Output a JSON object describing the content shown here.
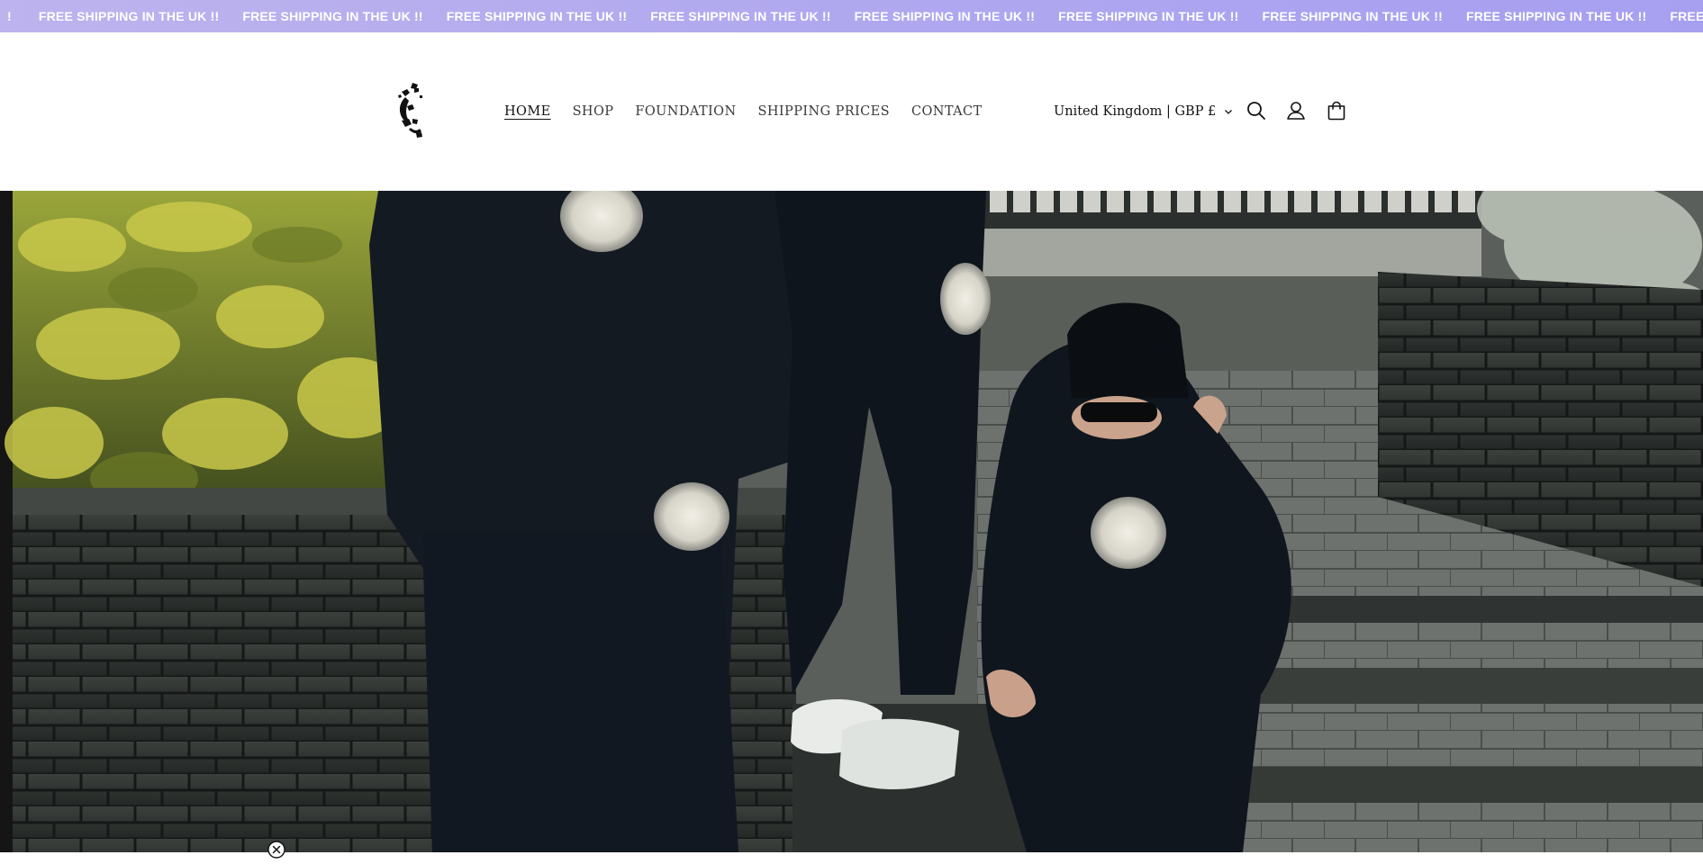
{
  "announcement": {
    "lead": "!",
    "text": "FREE SHIPPING IN THE UK !!",
    "repeat_count": 9
  },
  "header": {
    "logo_icon": "brand-logo-icon",
    "nav": [
      {
        "label": "HOME",
        "active": true
      },
      {
        "label": "SHOP",
        "active": false
      },
      {
        "label": "FOUNDATION",
        "active": false
      },
      {
        "label": "SHIPPING PRICES",
        "active": false
      },
      {
        "label": "CONTACT",
        "active": false
      }
    ],
    "region_selector": {
      "value": "United Kingdom | GBP £",
      "icon": "chevron-down-icon"
    },
    "icons": [
      "search-icon",
      "account-icon",
      "cart-icon"
    ]
  },
  "hero": {
    "image": "models-in-black-hoodies-on-brick-steps",
    "overlay_icon": "close-icon"
  },
  "colors": {
    "announcement_bg": "#b0a8ef",
    "announcement_text": "#ffffff",
    "text": "#121212"
  }
}
